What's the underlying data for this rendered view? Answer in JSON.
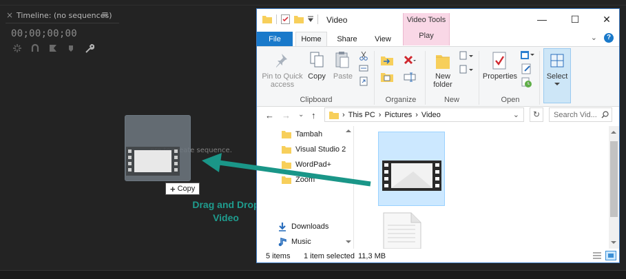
{
  "premiere": {
    "close_glyph": "×",
    "panel_title": "Timeline: (no sequences)",
    "menu_glyph": "≡",
    "timecode": "00;00;00;00",
    "drop_hint": "ere to create sequence."
  },
  "drag": {
    "copy_plus": "+",
    "copy_label": "Copy",
    "annotation_line1": "Drag and Drop",
    "annotation_line2": "Video",
    "arrow_color": "#1a9688"
  },
  "explorer": {
    "title": "Video",
    "context_tab_group": "Video Tools",
    "window_controls": {
      "minimize": "—",
      "maximize": "☐",
      "close": "✕"
    },
    "tabs": {
      "file": "File",
      "home": "Home",
      "share": "Share",
      "view": "View",
      "play": "Play"
    },
    "help_chevron": "⌄",
    "help_q": "?",
    "ribbon": {
      "pin_line1": "Pin to Quick",
      "pin_line2": "access",
      "copy": "Copy",
      "paste": "Paste",
      "group_clipboard": "Clipboard",
      "group_organize": "Organize",
      "new_folder_line1": "New",
      "new_folder_line2": "folder",
      "group_new": "New",
      "properties": "Properties",
      "group_open": "Open",
      "select": "Select"
    },
    "address": {
      "back": "←",
      "forward": "→",
      "recent": "⌄",
      "up": "↑",
      "segments": [
        "This PC",
        "Pictures",
        "Video"
      ],
      "separator": "›",
      "dropdown": "⌄",
      "refresh": "↻",
      "search_placeholder": "Search Vid..."
    },
    "nav_items": [
      "Tambah",
      "Visual Studio 2",
      "WordPad+",
      "Zoom",
      "Downloads",
      "Music"
    ],
    "status": {
      "count": "5 items",
      "selected": "1 item selected",
      "size": "11,3 MB"
    }
  },
  "colors": {
    "accent": "#1979ca",
    "teal": "#1f9c8e",
    "context_tab": "#f9d7e6"
  }
}
